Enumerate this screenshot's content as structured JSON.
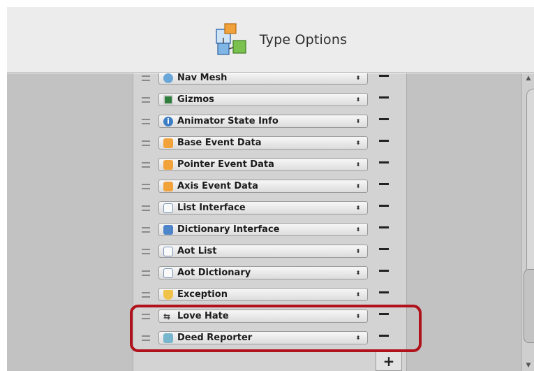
{
  "header": {
    "title": "Type Options",
    "icon": "type-options-icon"
  },
  "rows": [
    {
      "label": "Nav Mesh",
      "icon": "nav-mesh-icon"
    },
    {
      "label": "Gizmos",
      "icon": "gizmos-icon"
    },
    {
      "label": "Animator State Info",
      "icon": "info-icon"
    },
    {
      "label": "Base Event Data",
      "icon": "event-data-icon"
    },
    {
      "label": "Pointer Event Data",
      "icon": "event-data-icon"
    },
    {
      "label": "Axis Event Data",
      "icon": "event-data-icon"
    },
    {
      "label": "List Interface",
      "icon": "list-icon"
    },
    {
      "label": "Dictionary Interface",
      "icon": "dictionary-icon"
    },
    {
      "label": "Aot List",
      "icon": "list-icon"
    },
    {
      "label": "Aot Dictionary",
      "icon": "list-icon"
    },
    {
      "label": "Exception",
      "icon": "exception-icon"
    },
    {
      "label": "Love Hate",
      "icon": "love-hate-icon"
    },
    {
      "label": "Deed Reporter",
      "icon": "deed-reporter-icon"
    }
  ],
  "controls": {
    "remove_label": "−",
    "add_label": "+",
    "dropdown_arrows": "⬍"
  },
  "highlight_color": "#b0111b"
}
